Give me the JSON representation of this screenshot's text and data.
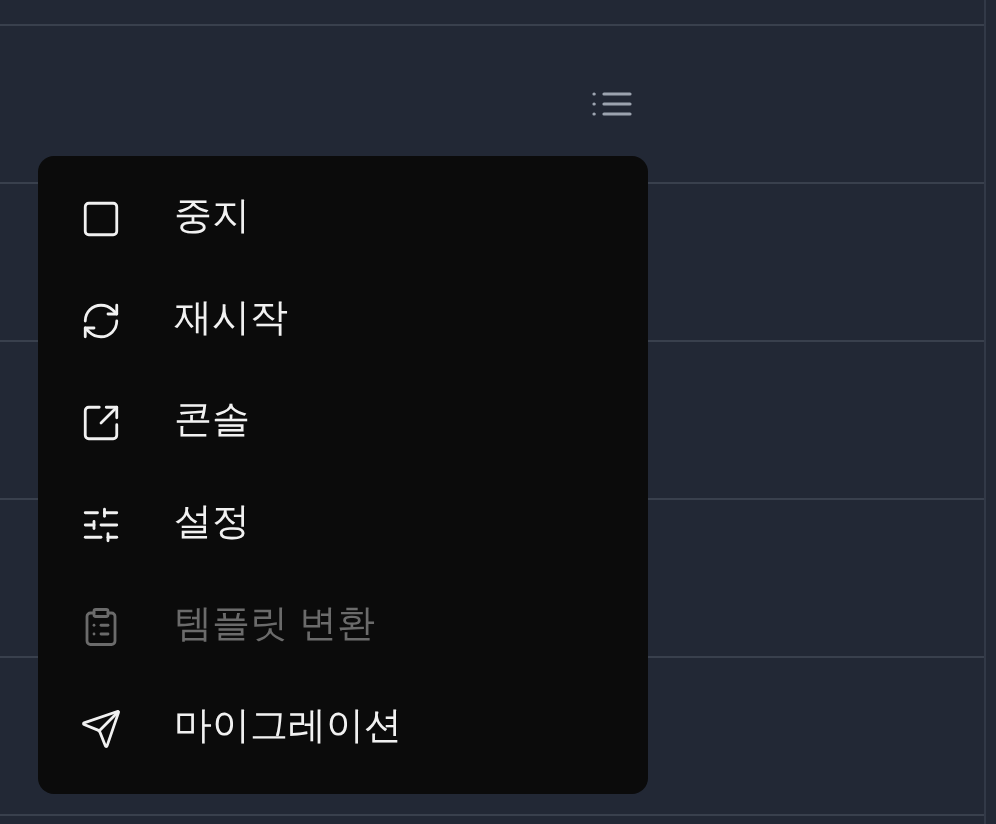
{
  "menu": {
    "items": [
      {
        "kind": "stop",
        "label": "중지",
        "disabled": false
      },
      {
        "kind": "restart",
        "label": "재시작",
        "disabled": false
      },
      {
        "kind": "console",
        "label": "콘솔",
        "disabled": false
      },
      {
        "kind": "settings",
        "label": "설정",
        "disabled": false
      },
      {
        "kind": "template",
        "label": "템플릿 변환",
        "disabled": true
      },
      {
        "kind": "migrate",
        "label": "마이그레이션",
        "disabled": false
      }
    ]
  }
}
